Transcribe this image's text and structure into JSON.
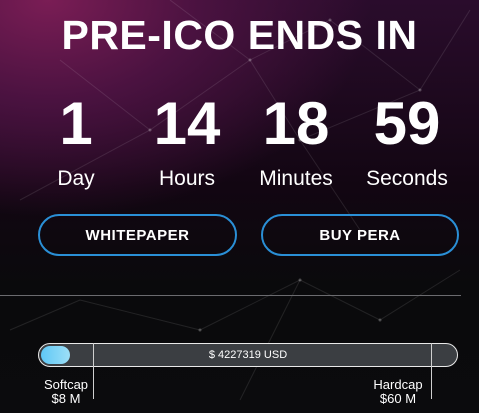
{
  "header": {
    "title": "PRE-ICO ENDS IN"
  },
  "countdown": [
    {
      "value": "1",
      "label": "Day"
    },
    {
      "value": "14",
      "label": "Hours"
    },
    {
      "value": "18",
      "label": "Minutes"
    },
    {
      "value": "59",
      "label": "Seconds"
    }
  ],
  "buttons": {
    "whitepaper": "WHITEPAPER",
    "buy": "BUY PERA"
  },
  "progress": {
    "raised_label": "$ 4227319 USD",
    "fill_fraction": 0.07,
    "softcap": {
      "label": "Softcap",
      "value": "$8 M"
    },
    "hardcap": {
      "label": "Hardcap",
      "value": "$60 M"
    }
  },
  "colors": {
    "accent": "#2a8fd6",
    "fill": "#5fc8f6",
    "bar_bg": "#3b3e42"
  }
}
